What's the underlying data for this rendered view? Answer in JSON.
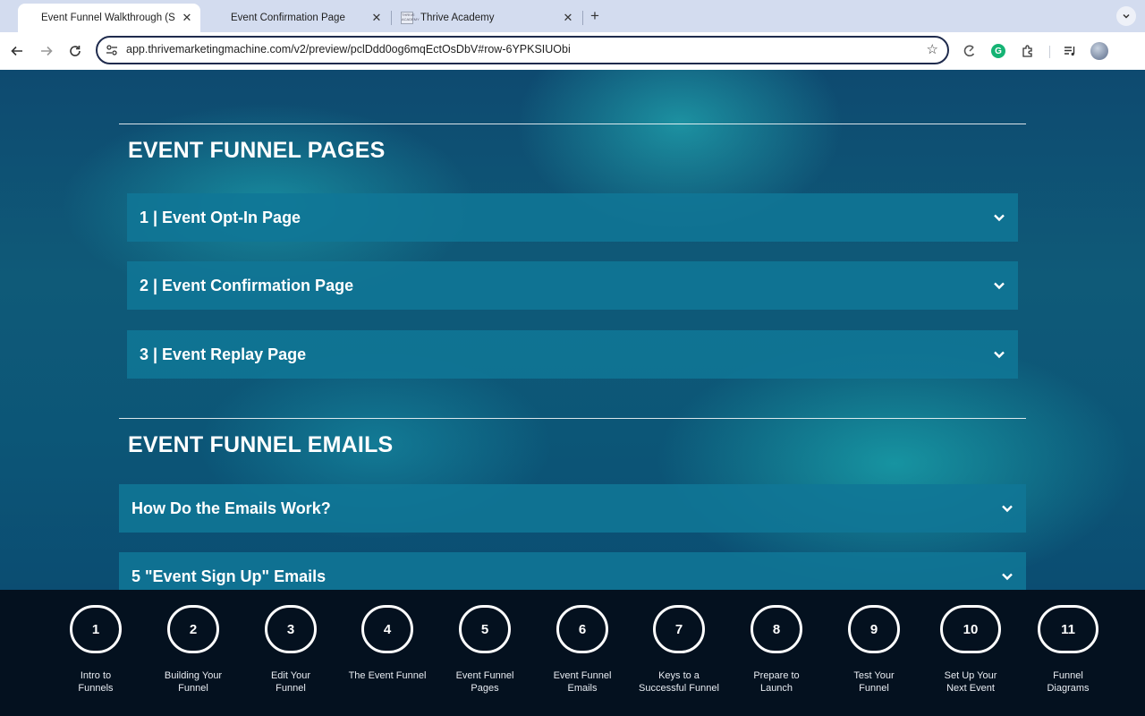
{
  "browser": {
    "tabs": [
      {
        "title": "Event Funnel Walkthrough (ST",
        "active": true
      },
      {
        "title": "Event Confirmation Page",
        "active": false
      },
      {
        "title": "Thrive Academy",
        "active": false,
        "favicon_text": "THRIVE ACADEMY"
      }
    ],
    "new_tab_symbol": "+",
    "url": "app.thrivemarketingmachine.com/v2/preview/pclDdd0og6mqEctOsDbV#row-6YPKSIUObi",
    "icons": {
      "back": "back-arrow-icon",
      "forward": "forward-arrow-icon",
      "reload": "reload-icon",
      "site_info": "tune-icon",
      "bookmark": "star-icon",
      "extension_1": "loading-circle-icon",
      "extension_2": "grammarly-icon",
      "extensions": "puzzle-icon",
      "media": "media-control-icon",
      "profile": "avatar"
    }
  },
  "page": {
    "sections": [
      {
        "title": "EVENT FUNNEL PAGES",
        "items": [
          "1 | Event Opt-In Page",
          "2 | Event Confirmation Page",
          "3 | Event Replay Page"
        ]
      },
      {
        "title": "EVENT FUNNEL EMAILS",
        "items": [
          "How Do the Emails Work?",
          "5 \"Event Sign Up\" Emails"
        ]
      }
    ]
  },
  "bottom_nav": {
    "steps": [
      {
        "number": "1",
        "label": "Intro to\nFunnels"
      },
      {
        "number": "2",
        "label": "Building Your\nFunnel"
      },
      {
        "number": "3",
        "label": "Edit Your\nFunnel"
      },
      {
        "number": "4",
        "label": "The Event Funnel"
      },
      {
        "number": "5",
        "label": "Event Funnel\nPages"
      },
      {
        "number": "6",
        "label": "Event Funnel\nEmails"
      },
      {
        "number": "7",
        "label": "Keys to a\nSuccessful Funnel"
      },
      {
        "number": "8",
        "label": "Prepare to\nLaunch"
      },
      {
        "number": "9",
        "label": "Test Your\nFunnel"
      },
      {
        "number": "10",
        "label": "Set Up Your\nNext Event"
      },
      {
        "number": "11",
        "label": "Funnel\nDiagrams"
      }
    ]
  },
  "colors": {
    "tab_strip": "#d3dcef",
    "page_bg": "#0e4a70",
    "accordion_bg": "#1076a0",
    "bottom_nav_bg": "#04111f",
    "text_white": "#ffffff"
  }
}
